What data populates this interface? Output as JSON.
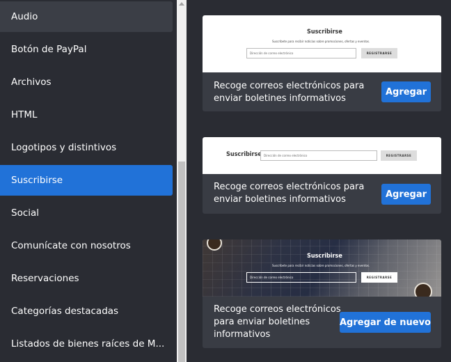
{
  "sidebar": {
    "items": [
      {
        "label": "Audio"
      },
      {
        "label": "Botón de PayPal"
      },
      {
        "label": "Archivos"
      },
      {
        "label": "HTML"
      },
      {
        "label": "Logotipos y distintivos"
      },
      {
        "label": "Suscribirse"
      },
      {
        "label": "Social"
      },
      {
        "label": "Comunícate con nosotros"
      },
      {
        "label": "Reservaciones"
      },
      {
        "label": "Categorías destacadas"
      },
      {
        "label": "Listados de bienes raíces de M..."
      }
    ]
  },
  "cards": [
    {
      "preview": {
        "title": "Suscribirse",
        "subtitle": "Suscríbete para recibir noticias sobre promociones, ofertas y eventos.",
        "input_placeholder": "Dirección de correo electrónico",
        "button": "REGISTRARSE"
      },
      "description": "Recoge correos electrónicos para enviar boletines informativos",
      "button": "Agregar"
    },
    {
      "preview": {
        "title": "Suscribirse",
        "input_placeholder": "Dirección de correo electrónico",
        "button": "REGISTRARSE"
      },
      "description": "Recoge correos electrónicos para enviar boletines informativos",
      "button": "Agregar"
    },
    {
      "preview": {
        "title": "Suscribirse",
        "subtitle": "Suscríbete para recibir noticias sobre promociones, ofertas y eventos.",
        "input_placeholder": "Dirección de correo electrónico",
        "button": "REGISTRARSE"
      },
      "description": "Recoge correos electrónicos para enviar boletines informativos",
      "button": "Agregar de nuevo"
    }
  ],
  "colors": {
    "background": "#2a2c33",
    "card": "#393c44",
    "accent": "#2172d8",
    "hover": "#3b3e46"
  }
}
